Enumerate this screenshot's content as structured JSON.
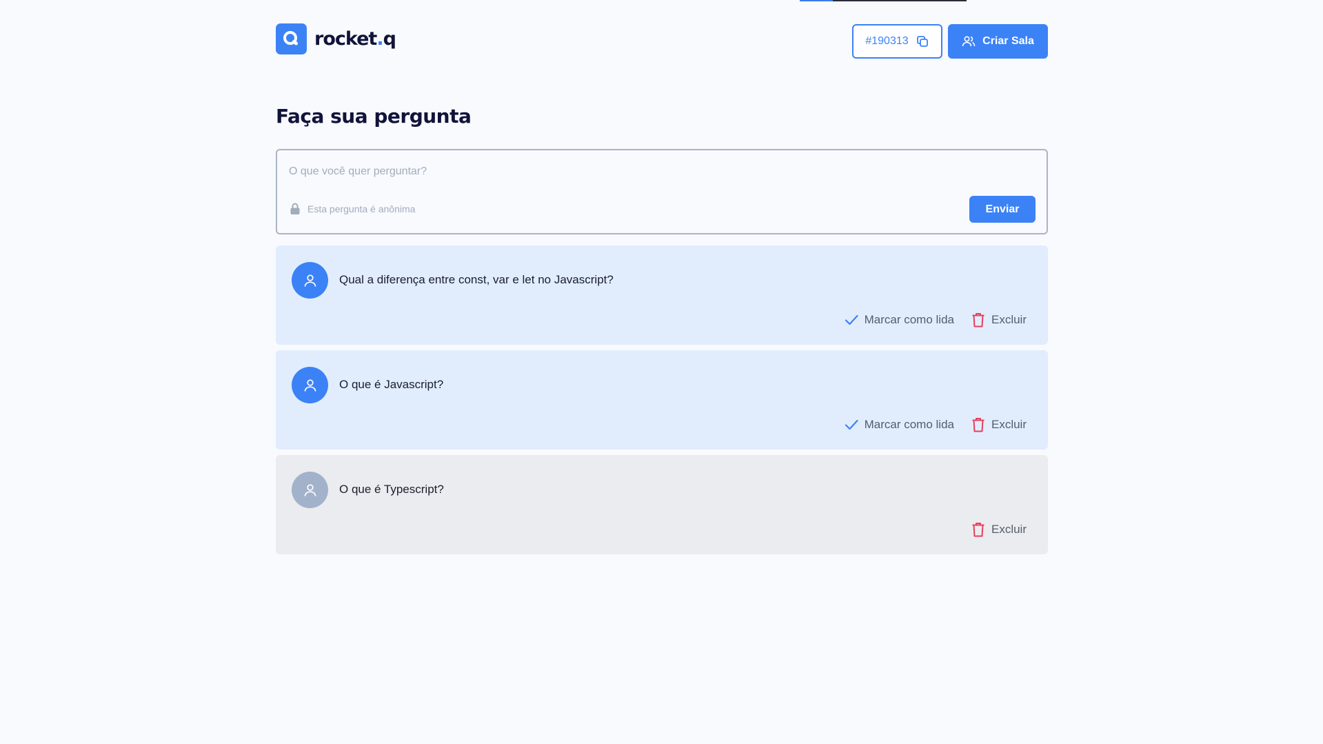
{
  "brand": {
    "name": "rocket",
    "dot": ".",
    "suffix": "q"
  },
  "header": {
    "room_code": "#190313",
    "create_room_label": "Criar Sala"
  },
  "page_title": "Faça sua pergunta",
  "ask": {
    "placeholder": "O que você quer perguntar?",
    "anon_label": "Esta pergunta é anônima",
    "send_label": "Enviar"
  },
  "questions": [
    {
      "text": "Qual a diferença entre const, var e let no Javascript?",
      "status": "unread",
      "mark_label": "Marcar como lida",
      "delete_label": "Excluir"
    },
    {
      "text": "O que é Javascript?",
      "status": "unread",
      "mark_label": "Marcar como lida",
      "delete_label": "Excluir"
    },
    {
      "text": "O que é Typescript?",
      "status": "read",
      "delete_label": "Excluir"
    }
  ],
  "colors": {
    "accent": "#3b82f6",
    "unread_bg": "#e1edfd",
    "read_bg": "#ebecef",
    "danger": "#e73f5d"
  }
}
